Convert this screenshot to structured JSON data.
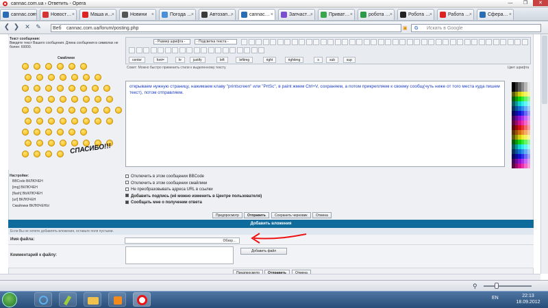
{
  "window": {
    "title": "cannac.com.ua › Ответить - Opera",
    "controls": [
      "—",
      "❐",
      "✕"
    ]
  },
  "tabs": [
    {
      "label": "cannac.com.ua",
      "color": "#2a6db3",
      "active": false
    },
    {
      "label": "Новост…",
      "color": "#d63333",
      "active": false
    },
    {
      "label": "Маша и…",
      "color": "#d22",
      "active": false
    },
    {
      "label": "Новини",
      "color": "#555",
      "active": false
    },
    {
      "label": "Погода …",
      "color": "#4a8fd8",
      "active": false
    },
    {
      "label": "Автозап…",
      "color": "#3a3a3a",
      "active": false
    },
    {
      "label": "cannac…",
      "color": "#2a6db3",
      "active": true
    },
    {
      "label": "Запчаст…",
      "color": "#7a4fd0",
      "active": false
    },
    {
      "label": "Приват…",
      "color": "#3aa54a",
      "active": false
    },
    {
      "label": "робота …",
      "color": "#2c9a48",
      "active": false
    },
    {
      "label": "Робота …",
      "color": "#222",
      "active": false
    },
    {
      "label": "Работа …",
      "color": "#d22",
      "active": false
    },
    {
      "label": "Сфера…",
      "color": "#2a6db3",
      "active": false
    }
  ],
  "address": {
    "label": "Веб",
    "url": "cannac.com.ua/forum/posting.php",
    "search_placeholder": "Искать в Google"
  },
  "left": {
    "body_label": "Текст сообщения:",
    "body_hint": "Введите текст Вашего сообщения. Длина сообщения в символах не более: 60000.",
    "smilies_title": "Смайлики",
    "spasibo": "СПАСИБО!!!",
    "settings_title": "Настройки:",
    "settings": [
      "BBCode ВКЛЮЧЕН",
      "[img] ВКЛЮЧЕН",
      "[flash] ВЫКЛЮЧЕН",
      "[url] ВКЛЮЧЕН",
      "Смайлики ВКЛЮЧЕНЫ"
    ]
  },
  "toolbar": {
    "font_select": "- Размер шрифта -",
    "color_select": "- Подсветка текста -",
    "tags": [
      "center",
      "font=",
      "hr",
      "justify",
      "left",
      "leftimg",
      "right",
      "rightimg",
      "s",
      "sub",
      "sup"
    ],
    "hint": "Совет: Можно быстро применить стили к выделенному тексту.",
    "palette_label": "Цвет шрифта"
  },
  "message_text": "открываем нужную страницу, нажимаем клаву \"printscreen\" или \"PrtSc\", в paint жмем Ctrl+V, сохраняем, а потом прикрепляем к своему сообщ(чуть ниже от того места куда пишем текст), потом отправляем.",
  "options": [
    {
      "label": "Отключить в этом сообщении BBCode",
      "checked": false
    },
    {
      "label": "Отключить в этом сообщении смайлики",
      "checked": false
    },
    {
      "label": "Не преобразовывать адреса URL в ссылки",
      "checked": false
    },
    {
      "label": "Добавить подпись (её можно изменить в Центре пользователя)",
      "checked": true
    },
    {
      "label": "Сообщать мне о получении ответа",
      "checked": true
    }
  ],
  "buttons": {
    "preview": "Предпросмотр",
    "submit": "Отправить",
    "save": "Сохранить черновик",
    "cancel": "Отмена"
  },
  "attach": {
    "header": "Добавить вложения",
    "note": "Если Вы не хотите добавлять вложения, оставьте поля пустыми.",
    "file_label": "Имя файла:",
    "browse": "Обзор…",
    "comment_label": "Комментарий к файлу:",
    "add_file": "Добавить файл"
  },
  "taskbar": {
    "lang": "EN",
    "time": "22:13",
    "date": "18.09.2012"
  }
}
